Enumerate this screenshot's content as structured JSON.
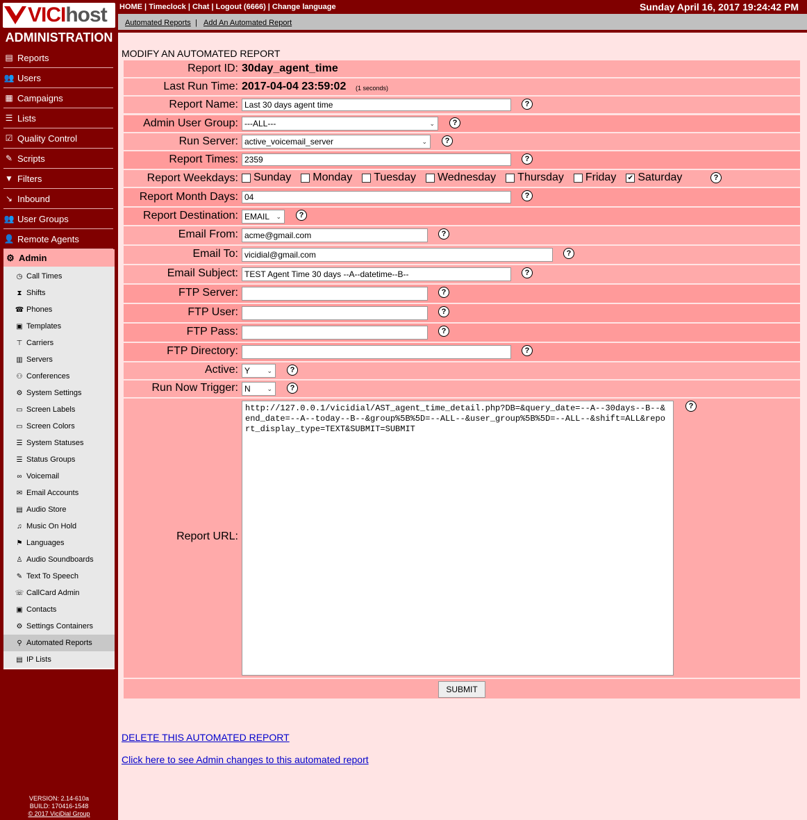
{
  "brand": {
    "vici": "VICI",
    "host": "host"
  },
  "sidebar": {
    "title": "ADMINISTRATION",
    "items": [
      {
        "label": "Reports",
        "icon": "reports-icon"
      },
      {
        "label": "Users",
        "icon": "users-icon"
      },
      {
        "label": "Campaigns",
        "icon": "campaigns-icon"
      },
      {
        "label": "Lists",
        "icon": "lists-icon"
      },
      {
        "label": "Quality Control",
        "icon": "quality-control-icon"
      },
      {
        "label": "Scripts",
        "icon": "scripts-icon"
      },
      {
        "label": "Filters",
        "icon": "filter-icon"
      },
      {
        "label": "Inbound",
        "icon": "inbound-icon"
      },
      {
        "label": "User Groups",
        "icon": "user-groups-icon"
      },
      {
        "label": "Remote Agents",
        "icon": "remote-agents-icon"
      }
    ],
    "admin_label": "Admin",
    "admin_items": [
      "Call Times",
      "Shifts",
      "Phones",
      "Templates",
      "Carriers",
      "Servers",
      "Conferences",
      "System Settings",
      "Screen Labels",
      "Screen Colors",
      "System Statuses",
      "Status Groups",
      "Voicemail",
      "Email Accounts",
      "Audio Store",
      "Music On Hold",
      "Languages",
      "Audio Soundboards",
      "Text To Speech",
      "CallCard Admin",
      "Contacts",
      "Settings Containers",
      "Automated Reports",
      "IP Lists"
    ],
    "active_admin_item": "Automated Reports",
    "version": "VERSION: 2.14-610a",
    "build": "BUILD: 170416-1548",
    "copyright": "© 2017 ViciDial Group"
  },
  "topbar": {
    "links": "HOME | Timeclock | Chat | Logout (6666) | Change language",
    "datetime": "Sunday April 16, 2017 19:24:42 PM"
  },
  "subnav": {
    "link1": "Automated Reports",
    "sep": "|",
    "link2": "Add An Automated Report"
  },
  "form": {
    "title": "MODIFY AN AUTOMATED REPORT",
    "report_id_label": "Report ID:",
    "report_id": "30day_agent_time",
    "last_run_label": "Last Run Time:",
    "last_run": "2017-04-04 23:59:02",
    "last_run_note": "(1 seconds)",
    "report_name_label": "Report Name:",
    "report_name": "Last 30 days agent time",
    "admin_group_label": "Admin User Group:",
    "admin_group": "---ALL---",
    "run_server_label": "Run Server:",
    "run_server": "active_voicemail_server",
    "report_times_label": "Report Times:",
    "report_times": "2359",
    "weekdays_label": "Report Weekdays:",
    "weekdays": [
      {
        "day": "Sunday",
        "checked": false
      },
      {
        "day": "Monday",
        "checked": false
      },
      {
        "day": "Tuesday",
        "checked": false
      },
      {
        "day": "Wednesday",
        "checked": false
      },
      {
        "day": "Thursday",
        "checked": false
      },
      {
        "day": "Friday",
        "checked": false
      },
      {
        "day": "Saturday",
        "checked": true
      }
    ],
    "month_days_label": "Report Month Days:",
    "month_days": "04",
    "destination_label": "Report Destination:",
    "destination": "EMAIL",
    "email_from_label": "Email From:",
    "email_from": "acme@gmail.com",
    "email_to_label": "Email To:",
    "email_to": "vicidial@gmail.com",
    "email_subject_label": "Email Subject:",
    "email_subject": "TEST Agent Time 30 days --A--datetime--B--",
    "ftp_server_label": "FTP Server:",
    "ftp_server": "",
    "ftp_user_label": "FTP User:",
    "ftp_user": "",
    "ftp_pass_label": "FTP Pass:",
    "ftp_pass": "",
    "ftp_dir_label": "FTP Directory:",
    "ftp_dir": "",
    "active_label": "Active:",
    "active": "Y",
    "run_now_label": "Run Now Trigger:",
    "run_now": "N",
    "url_label": "Report URL:",
    "url": "http://127.0.0.1/vicidial/AST_agent_time_detail.php?DB=&query_date=--A--30days--B--&end_date=--A--today--B--&group%5B%5D=--ALL--&user_group%5B%5D=--ALL--&shift=ALL&report_display_type=TEXT&SUBMIT=SUBMIT",
    "help_glyph": "?",
    "submit_label": "SUBMIT"
  },
  "bottom_links": {
    "delete": "DELETE THIS AUTOMATED REPORT",
    "changes": "Click here to see Admin changes to this automated report"
  }
}
